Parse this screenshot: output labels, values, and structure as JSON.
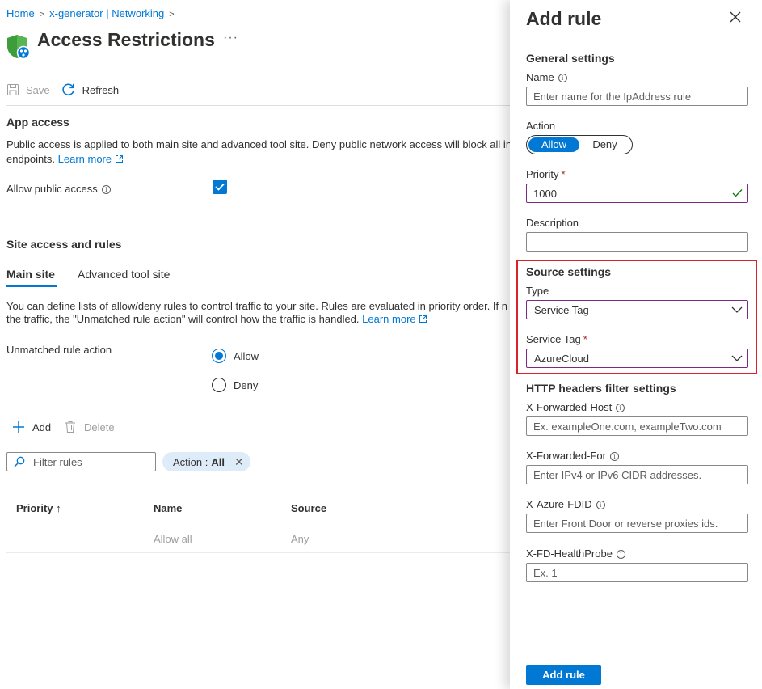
{
  "breadcrumb": {
    "items": [
      "Home",
      "x-generator | Networking"
    ]
  },
  "page": {
    "title": "Access Restrictions",
    "more": "···"
  },
  "toolbar": {
    "save_label": "Save",
    "refresh_label": "Refresh"
  },
  "app_access": {
    "title": "App access",
    "description_line1": "Public access is applied to both main site and advanced tool site. Deny public network access will block all inc",
    "description_line2": "endpoints.",
    "learn_more": "Learn more",
    "allow_public_label": "Allow public access",
    "allow_public_checked": true
  },
  "site_access": {
    "title": "Site access and rules",
    "tabs": [
      {
        "label": "Main site",
        "selected": true
      },
      {
        "label": "Advanced tool site",
        "selected": false
      }
    ],
    "description_line1": "You can define lists of allow/deny rules to control traffic to your site. Rules are evaluated in priority order. If n",
    "description_line2": "the traffic, the \"Unmatched rule action\" will control how the traffic is handled.",
    "learn_more": "Learn more",
    "unmatched_label": "Unmatched rule action",
    "unmatched_options": [
      {
        "label": "Allow",
        "checked": true
      },
      {
        "label": "Deny",
        "checked": false
      }
    ]
  },
  "rules_toolbar": {
    "add_label": "Add",
    "delete_label": "Delete"
  },
  "filter": {
    "placeholder": "Filter rules",
    "pill_prefix": "Action :",
    "pill_value": "All"
  },
  "table": {
    "columns": [
      "Priority ↑",
      "Name",
      "Source"
    ],
    "rows": [
      {
        "priority": "",
        "name": "Allow all",
        "source": "Any"
      }
    ]
  },
  "panel": {
    "title": "Add rule",
    "general_title": "General settings",
    "name_label": "Name",
    "name_placeholder": "Enter name for the IpAddress rule",
    "action_label": "Action",
    "action_options": [
      "Allow",
      "Deny"
    ],
    "action_selected": "Allow",
    "priority_label": "Priority",
    "priority_value": "1000",
    "description_label": "Description",
    "description_value": "",
    "source_title": "Source settings",
    "type_label": "Type",
    "type_value": "Service Tag",
    "service_tag_label": "Service Tag",
    "service_tag_value": "AzureCloud",
    "http_title": "HTTP headers filter settings",
    "xfh_label": "X-Forwarded-Host",
    "xfh_placeholder": "Ex. exampleOne.com, exampleTwo.com",
    "xff_label": "X-Forwarded-For",
    "xff_placeholder": "Enter IPv4 or IPv6 CIDR addresses.",
    "fdid_label": "X-Azure-FDID",
    "fdid_placeholder": "Enter Front Door or reverse proxies ids.",
    "probe_label": "X-FD-HealthProbe",
    "probe_placeholder": "Ex. 1",
    "submit_label": "Add rule"
  },
  "colors": {
    "accent": "#0078d4",
    "highlight_border": "#d9222a",
    "valid_check": "#107c10",
    "field_focus_border": "#7a2a85"
  }
}
